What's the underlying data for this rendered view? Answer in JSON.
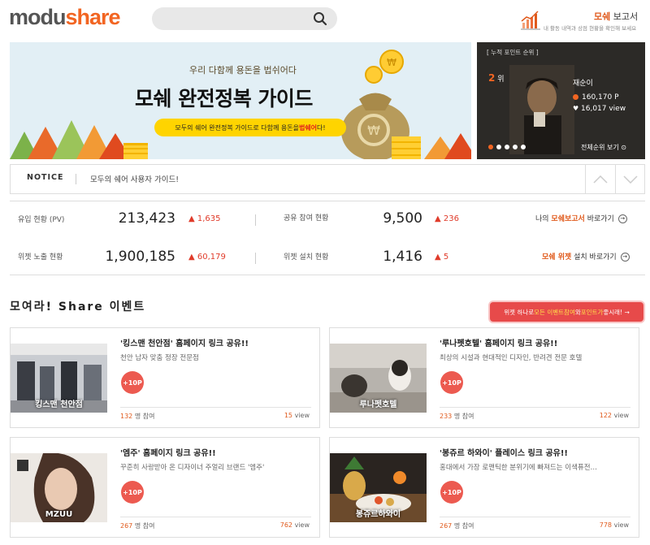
{
  "header": {
    "logo_part1": "modu",
    "logo_part2": "share",
    "search_placeholder": "",
    "report_title_accent": "모쉐",
    "report_title_rest": " 보고서",
    "report_sub": "내 활동 내역과 상점 현황을 확인해 보세요"
  },
  "banner": {
    "subtitle": "우리 다함께 용돈을 법쉬어다",
    "title": "모쉐 완전정복 가이드",
    "pill_before": "모두의 쉐어 완전정복 가이드로 다함께 용돈을 ",
    "pill_accent": "법쉐어",
    "pill_after": "다!"
  },
  "ranking": {
    "label": "[ 누적 포인트 순위 ]",
    "rank_number": "2",
    "rank_suffix": "위",
    "name": "재순이",
    "points": "160,170 P",
    "views": "16,017 view",
    "view_all": "전체순위 보기 ⊙"
  },
  "notice": {
    "label": "NOTICE",
    "text": "모두의 쉐어 사용자 가이드!"
  },
  "stats": {
    "inflow_label": "유입 현황 (PV)",
    "inflow_value": "213,423",
    "inflow_delta": "▲ 1,635",
    "share_label": "공유 참여 현황",
    "share_value": "9,500",
    "share_delta": "▲ 236",
    "my_report_prefix": "나의 ",
    "my_report_accent": "모쉐보고서",
    "my_report_suffix": " 바로가기",
    "widget_label": "위젯 노출 현황",
    "widget_value": "1,900,185",
    "widget_delta": "▲ 60,179",
    "install_label": "위젯 설치 현황",
    "install_value": "1,416",
    "install_delta": "▲ 5",
    "widget_link_accent": "모쉐 위젯",
    "widget_link_suffix": " 설치 바로가기"
  },
  "events": {
    "title": "모여라! Share 이벤트",
    "promo_before": "위젯 하나로 ",
    "promo_accent1": "모든 이벤트참여",
    "promo_mid": "와 ",
    "promo_accent2": "포인트가",
    "promo_after": " 좋시래! →",
    "cards": [
      {
        "title": "'킹스맨 천안점' 홈페이지 링크 공유!!",
        "desc": "천안 남자 맞춤 정장 전문점",
        "img_label": "킹스맨 천안점",
        "badge": "+10P",
        "participants": "132",
        "participants_suffix": " 명 참여",
        "views": "15",
        "views_suffix": " view"
      },
      {
        "title": "'루나펫호텔' 홈페이지 링크 공유!!",
        "desc": "최상의 시설과 현대적인 디자인, 반려견 전문 호텔",
        "img_label": "루나펫호텔",
        "badge": "+10P",
        "participants": "233",
        "participants_suffix": " 명 참여",
        "views": "122",
        "views_suffix": " view"
      },
      {
        "title": "'엠주' 홈페이지 링크 공유!!",
        "desc": "꾸준히 사랑받아 온 디자이너 주얼리 브랜드 '엠주'",
        "img_label": "MZUU",
        "badge": "+10P",
        "participants": "267",
        "participants_suffix": " 명 참여",
        "views": "762",
        "views_suffix": " view"
      },
      {
        "title": "'봉쥬르 하와이' 플레이스 링크 공유!!",
        "desc": "홍대에서 가장 로맨틱한 분위기에 빠져드는 이색퓨전…",
        "img_label": "봉쥬르하와이",
        "badge": "+10P",
        "participants": "267",
        "participants_suffix": " 명 참여",
        "views": "778",
        "views_suffix": " view"
      }
    ]
  }
}
